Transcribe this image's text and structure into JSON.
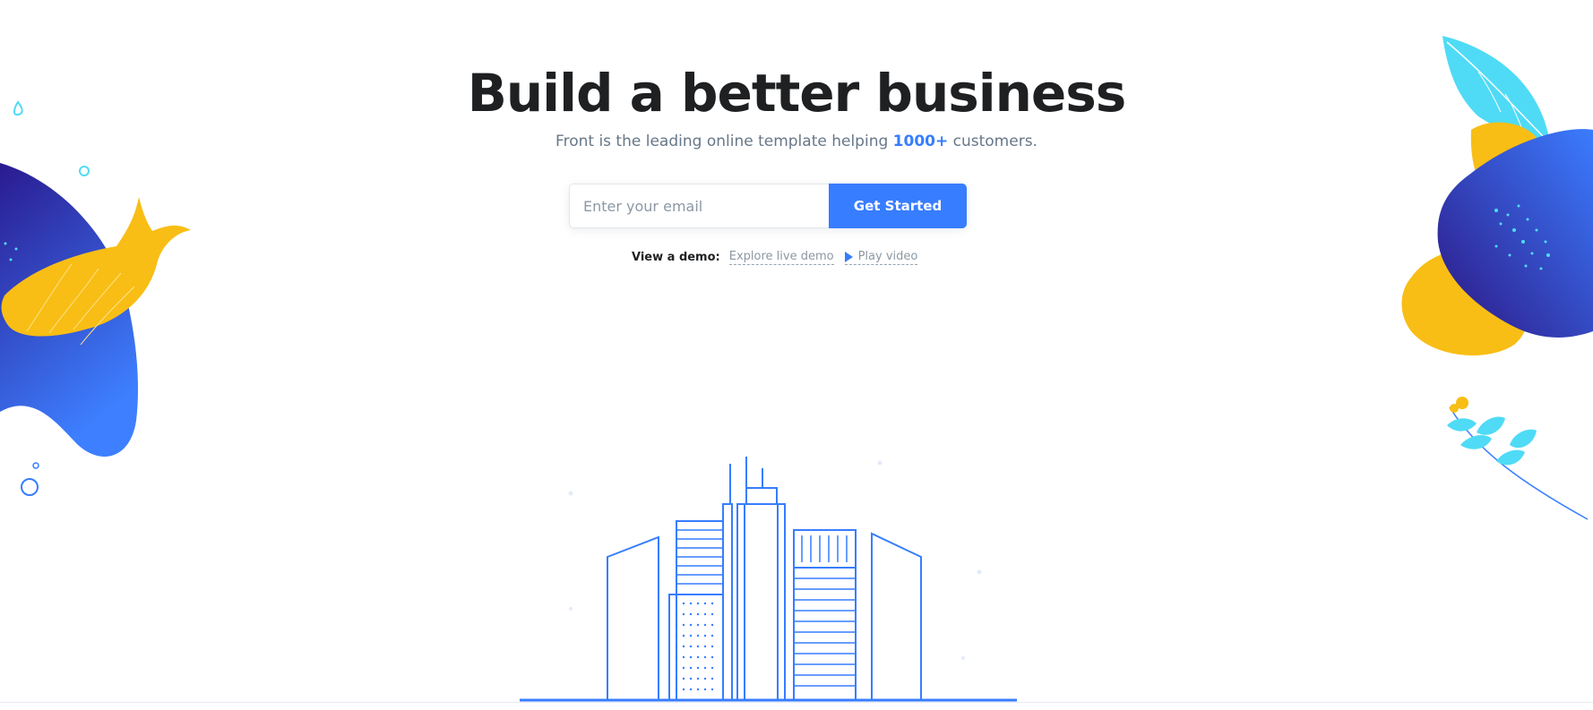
{
  "hero": {
    "title": "Build a better business",
    "subtitle_prefix": "Front is the leading online template helping ",
    "subtitle_highlight": "1000+",
    "subtitle_suffix": " customers."
  },
  "signup": {
    "email_placeholder": "Enter your email",
    "email_value": "",
    "button_label": "Get Started"
  },
  "demo": {
    "label": "View a demo:",
    "explore_link": "Explore live demo",
    "video_link": "Play video"
  },
  "icons": {
    "play": "play-icon",
    "city": "city-buildings-illustration",
    "left_blob": "left-blob-illustration",
    "right_blob": "right-blob-illustration"
  },
  "colors": {
    "accent": "#377dff",
    "heading": "#1e2022",
    "muted": "#677788",
    "yellow": "#f8be15",
    "indigo": "#2d1582",
    "cyan": "#4fdbf5"
  }
}
